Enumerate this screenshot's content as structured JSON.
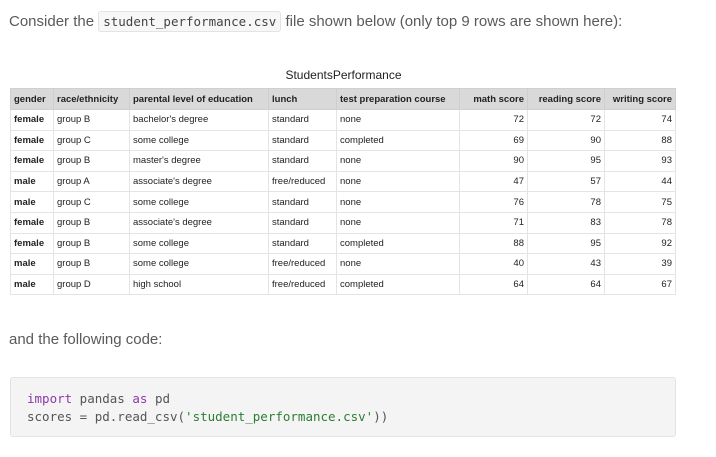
{
  "intro": {
    "before": "Consider the ",
    "filename": "student_performance.csv",
    "after": " file shown below (only top 9 rows are shown here):"
  },
  "table": {
    "title": "StudentsPerformance",
    "headers": [
      "gender",
      "race/ethnicity",
      "parental level of education",
      "lunch",
      "test preparation course",
      "math score",
      "reading score",
      "writing score"
    ],
    "rows": [
      [
        "female",
        "group B",
        "bachelor's degree",
        "standard",
        "none",
        "72",
        "72",
        "74"
      ],
      [
        "female",
        "group C",
        "some college",
        "standard",
        "completed",
        "69",
        "90",
        "88"
      ],
      [
        "female",
        "group B",
        "master's degree",
        "standard",
        "none",
        "90",
        "95",
        "93"
      ],
      [
        "male",
        "group A",
        "associate's degree",
        "free/reduced",
        "none",
        "47",
        "57",
        "44"
      ],
      [
        "male",
        "group C",
        "some college",
        "standard",
        "none",
        "76",
        "78",
        "75"
      ],
      [
        "female",
        "group B",
        "associate's degree",
        "standard",
        "none",
        "71",
        "83",
        "78"
      ],
      [
        "female",
        "group B",
        "some college",
        "standard",
        "completed",
        "88",
        "95",
        "92"
      ],
      [
        "male",
        "group B",
        "some college",
        "free/reduced",
        "none",
        "40",
        "43",
        "39"
      ],
      [
        "male",
        "group D",
        "high school",
        "free/reduced",
        "completed",
        "64",
        "64",
        "67"
      ]
    ]
  },
  "follow_text": "and the following code:",
  "code": {
    "line1": {
      "kw1": "import",
      "mid": " pandas ",
      "kw2": "as",
      "end": " pd"
    },
    "line2": {
      "start": "scores = pd.read_csv(",
      "str": "'student_performance.csv'",
      "end": "))"
    }
  }
}
